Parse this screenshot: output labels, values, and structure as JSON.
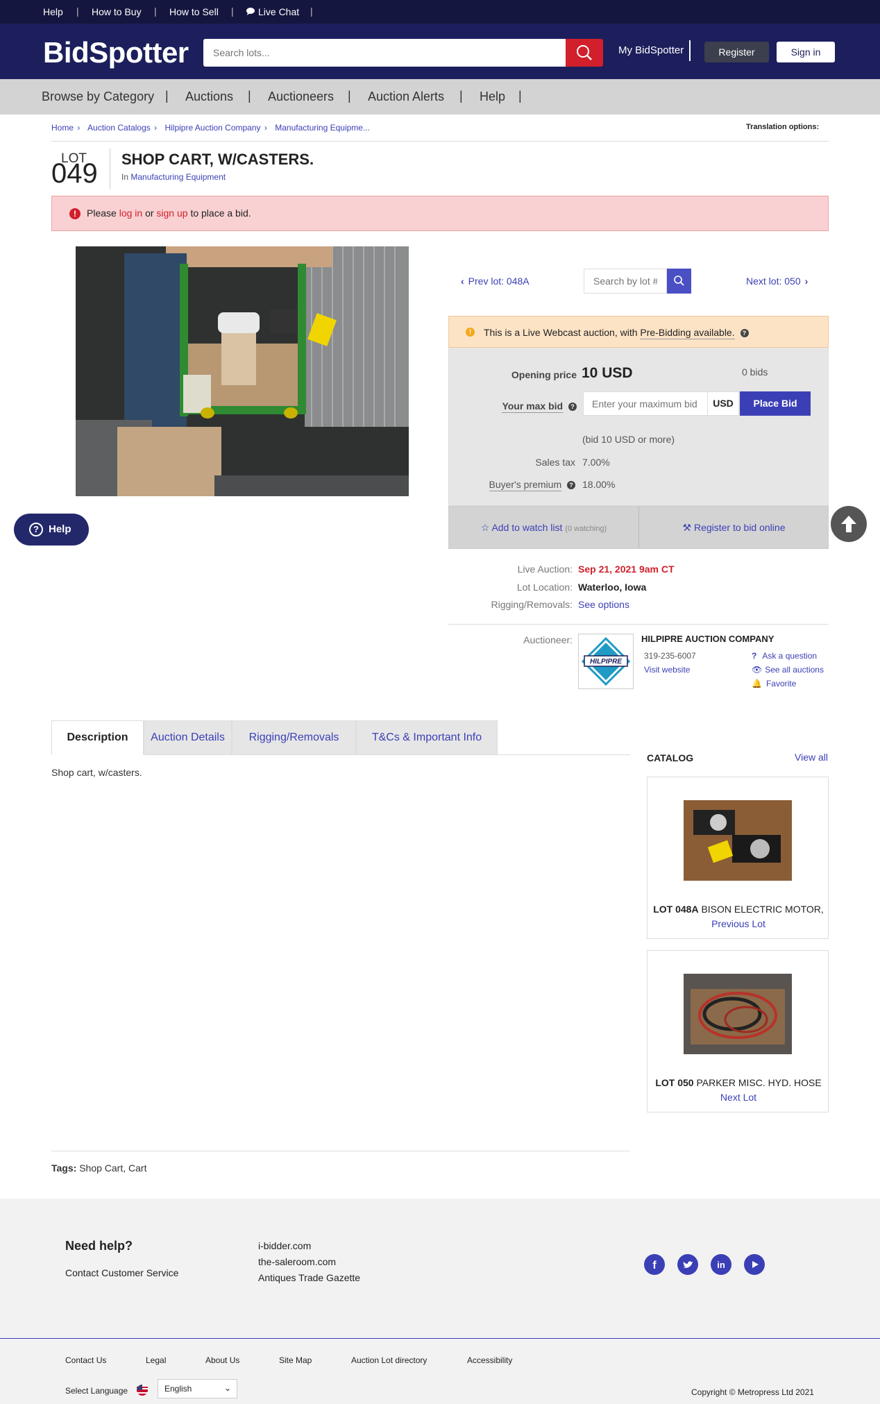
{
  "utility_bar": {
    "help": "Help",
    "how_to_buy": "How to Buy",
    "how_to_sell": "How to Sell",
    "live_chat": "Live Chat"
  },
  "header": {
    "logo": "BidSpotter",
    "search_placeholder": "Search lots...",
    "my_bidspotter": "My BidSpotter",
    "register": "Register",
    "sign_in": "Sign in"
  },
  "nav": {
    "items": [
      "Browse by Category",
      "Auctions",
      "Auctioneers",
      "Auction Alerts",
      "Help"
    ]
  },
  "breadcrumb": {
    "items": [
      "Home",
      "Auction Catalogs",
      "Hilpipre Auction Company",
      "Manufacturing Equipme..."
    ],
    "translation": "Translation options:"
  },
  "lot": {
    "label": "LOT",
    "number": "049",
    "title": "SHOP CART, W/CASTERS.",
    "in_label": "In",
    "category": "Manufacturing Equipment"
  },
  "alert": {
    "please": "Please",
    "log_in": "log in",
    "or": "or",
    "sign_up": "sign up",
    "suffix": "to place a bid."
  },
  "lot_nav": {
    "prev": "Prev lot: 048A",
    "search_placeholder": "Search by lot #",
    "next": "Next lot: 050"
  },
  "bid": {
    "webcast_text": "This is a Live Webcast auction, with",
    "webcast_link": "Pre-Bidding available.",
    "opening_price_label": "Opening price",
    "opening_price": "10 USD",
    "bids": "0 bids",
    "your_max_bid_label": "Your max bid",
    "max_bid_placeholder": "Enter your maximum bid",
    "currency": "USD",
    "place_bid": "Place Bid",
    "hint": "(bid 10 USD or more)",
    "sales_tax_label": "Sales tax",
    "sales_tax": "7.00%",
    "buyers_premium_label": "Buyer's premium",
    "buyers_premium": "18.00%",
    "watch": "Add to watch list",
    "watching": "(0 watching)",
    "register_to_bid": "Register to bid online"
  },
  "info": {
    "live_auction_label": "Live Auction:",
    "live_auction": "Sep 21, 2021 9am CT",
    "location_label": "Lot Location:",
    "location": "Waterloo, Iowa",
    "rigging_label": "Rigging/Removals:",
    "rigging": "See options",
    "auctioneer_label": "Auctioneer:"
  },
  "auctioneer": {
    "logo_text": "HILPIPRE",
    "name": "HILPIPRE AUCTION COMPANY",
    "phone": "319-235-6007",
    "website": "Visit website",
    "ask": "Ask a question",
    "see_all": "See all auctions",
    "favorite": "Favorite"
  },
  "help_button": "Help",
  "tabs": [
    "Description",
    "Auction Details",
    "Rigging/Removals",
    "T&Cs & Important Info"
  ],
  "description": "Shop cart, w/casters.",
  "catalog": {
    "title": "CATALOG",
    "view_all": "View all",
    "cards": [
      {
        "lot": "LOT 048A",
        "name": "BISON ELECTRIC MOTOR,",
        "link": "Previous Lot"
      },
      {
        "lot": "LOT 050",
        "name": "PARKER MISC. HYD. HOSE",
        "link": "Next Lot"
      }
    ]
  },
  "tags": {
    "label": "Tags:",
    "values": "Shop Cart, Cart"
  },
  "footer": {
    "need_help": "Need help?",
    "contact": "Contact Customer Service",
    "links": [
      "i-bidder.com",
      "the-saleroom.com",
      "Antiques Trade Gazette"
    ],
    "social": [
      "facebook-icon",
      "twitter-icon",
      "linkedin-icon",
      "youtube-icon"
    ],
    "bottom_links": [
      "Contact Us",
      "Legal",
      "About Us",
      "Site Map",
      "Auction Lot directory",
      "Accessibility"
    ],
    "select_language": "Select Language",
    "language": "English",
    "copyright": "Copyright © Metropress Ltd 2021"
  },
  "colors": {
    "primary": "#1c1f5c",
    "accent": "#3b3fb6",
    "danger": "#d11f2b"
  }
}
